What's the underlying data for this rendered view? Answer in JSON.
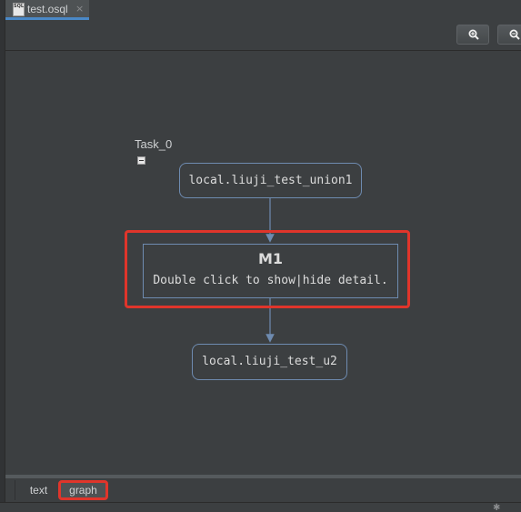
{
  "editor": {
    "tab": {
      "file_name": "test.osql",
      "icon_text": "SQL",
      "close_glyph": "×"
    }
  },
  "toolbar": {
    "zoom_in_icon": "zoom-in-icon",
    "zoom_out_icon": "zoom-out-icon"
  },
  "graph": {
    "task_label": "Task_0",
    "source_node": "local.liuji_test_union1",
    "stage": {
      "title": "M1",
      "hint": "Double click to show|hide detail."
    },
    "target_node": "local.liuji_test_u2"
  },
  "view_tabs": [
    {
      "label": "text",
      "selected": false
    },
    {
      "label": "graph",
      "selected": true
    }
  ],
  "colors": {
    "background": "#3c3f41",
    "node_border": "#6e8bb0",
    "highlight": "#e0352b",
    "active_tab_underline": "#4a88c7"
  }
}
